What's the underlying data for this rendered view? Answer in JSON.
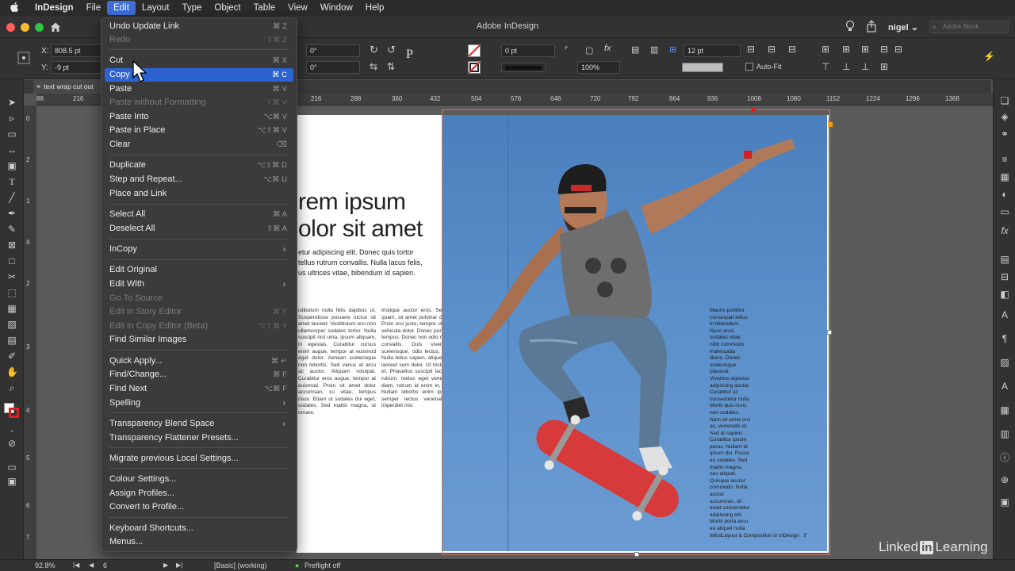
{
  "menubar": {
    "app": "InDesign",
    "items": [
      "File",
      "Edit",
      "Layout",
      "Type",
      "Object",
      "Table",
      "View",
      "Window",
      "Help"
    ]
  },
  "titlebar": {
    "title": "Adobe InDesign",
    "user": "nigel",
    "stock_placeholder": "Adobe Stock"
  },
  "control": {
    "x_label": "X:",
    "x_value": "808.5 pt",
    "y_label": "Y:",
    "y_value": "-9 pt",
    "rotate_value": "0°",
    "shear_value": "0°",
    "stroke_weight": "0 pt",
    "opacity": "100%",
    "gutter": "12 pt",
    "autofit": "Auto-Fit"
  },
  "doc_tab": "text wrap cut out",
  "ruler_h": [
    "88",
    "216",
    "216",
    "288",
    "360",
    "432",
    "504",
    "576",
    "648",
    "720",
    "792",
    "864",
    "936",
    "1008",
    "1080",
    "1152",
    "1224",
    "1296",
    "1368"
  ],
  "ruler_v": [
    "0",
    "2",
    "1",
    "4",
    "2",
    "3",
    "4",
    "5",
    "6",
    "7"
  ],
  "document": {
    "headline_1": "rem ipsum",
    "headline_2": "olor sit amet",
    "intro_1": "etur adipiscing elit. Donec quis tortor",
    "intro_2": "tellus rutrum convallis. Nulla lacus felis,",
    "intro_3": "us ultrices vitae, bibendum id sapien.",
    "col1": "istibulum nulla felis dapibus ut. Suspendisse posuere luctus sit amet laoreet. Vestibulum orci non ullamcorper sodales tortor. Nulla suscipit nisi uma, ipsum aliquam, in egestas. Curabitur cursus enim augue, tempor at euismod eget dolor. Aenean scelerisque non lobortis. Sed varius at arcu ac auctor. Aliquam volutpat. Curabitur eros augue, tempor at euismod. Proin sit amet dolor accumsan, cu vitae, tempus risus. Etiam ut sodales dui eget, sodales. Sed mattis magna, ut ornare.",
    "col2": "tristique auctor eros. Sed vulputate ultrices quam, sit amet pulvinar diam ullamcorper eu. Proin orci justo, tempor ut enim eget, posuere vehicula dolor. Donec porta eros id sollicitudin tempus. Donec non odio nec magna dignissim convallis. Duis viverra sed lobortis scelerisque, odio lectus, eget cursus ipsum. Nulla tellus sapien, aliquet sit amet arcu quis, laoreet sem dolor. Ut tristique lacus in sagittis et. Phasellus suscipit lacinia. Nulla mattis at rutrum, metus eget venenatis feugiat. Justo diam, rutrum id enim in, mollis ultrices nibh. Nullam lobortis enim ipsum, sed hendrerit semper lectus venenatis. Praesent quis imperdiet nisi.",
    "col3": "Mauris porttitor consequat tellus in bibendum. Nunc eros, sodales vitae nibh commodo malesuada libero. Donec scelerisque placerat. Vivamus egestas adipiscing auctor. Curabitur ac consectetur nulla. Morbi quis nunc non sodales. Nam sit amet orci ac, venenatis et. Sed at sapien. Curabitur ipsum purus. Nullam id ipsum dui. Fusce eu sodales. Sed mattis magna, nec aliquet. Quisque auctor commodo. Nulla auctor accumsan, sit amet consectetur adipiscing elit. Morbi porta arcu eu aliquet nulla tellus.",
    "footer": "Layout & Composition in InDesign",
    "page_number": "7"
  },
  "edit_menu": {
    "items": [
      {
        "label": "Undo Update Link",
        "shortcut": "⌘ Z",
        "disabled": false,
        "highlighted": false
      },
      {
        "label": "Redo",
        "shortcut": "⇧⌘ Z",
        "disabled": true,
        "highlighted": false
      },
      {
        "label": "Cut",
        "shortcut": "⌘ X",
        "disabled": false,
        "highlighted": false
      },
      {
        "label": "Copy",
        "shortcut": "⌘ C",
        "disabled": false,
        "highlighted": true
      },
      {
        "label": "Paste",
        "shortcut": "⌘ V",
        "disabled": false,
        "highlighted": false
      },
      {
        "label": "Paste without Formatting",
        "shortcut": "⇧⌘ V",
        "disabled": true,
        "highlighted": false
      },
      {
        "label": "Paste Into",
        "shortcut": "⌥⌘ V",
        "disabled": false,
        "highlighted": false
      },
      {
        "label": "Paste in Place",
        "shortcut": "⌥⇧⌘ V",
        "disabled": false,
        "highlighted": false
      },
      {
        "label": "Clear",
        "shortcut": "⌫",
        "disabled": false,
        "highlighted": false
      },
      {
        "label": "Duplicate",
        "shortcut": "⌥⇧⌘ D",
        "disabled": false,
        "highlighted": false
      },
      {
        "label": "Step and Repeat...",
        "shortcut": "⌥⌘ U",
        "disabled": false,
        "highlighted": false
      },
      {
        "label": "Place and Link",
        "shortcut": "",
        "disabled": false,
        "highlighted": false
      },
      {
        "label": "Select All",
        "shortcut": "⌘ A",
        "disabled": false,
        "highlighted": false
      },
      {
        "label": "Deselect All",
        "shortcut": "⇧⌘ A",
        "disabled": false,
        "highlighted": false
      },
      {
        "label": "InCopy",
        "shortcut": "",
        "disabled": false,
        "highlighted": false,
        "submenu": true
      },
      {
        "label": "Edit Original",
        "shortcut": "",
        "disabled": false,
        "highlighted": false
      },
      {
        "label": "Edit With",
        "shortcut": "",
        "disabled": false,
        "highlighted": false,
        "submenu": true
      },
      {
        "label": "Go To Source",
        "shortcut": "",
        "disabled": true,
        "highlighted": false
      },
      {
        "label": "Edit in Story Editor",
        "shortcut": "⌘ Y",
        "disabled": true,
        "highlighted": false
      },
      {
        "label": "Edit in Copy Editor (Beta)",
        "shortcut": "⌥⇧⌘ Y",
        "disabled": true,
        "highlighted": false
      },
      {
        "label": "Find Similar Images",
        "shortcut": "",
        "disabled": false,
        "highlighted": false
      },
      {
        "label": "Quick Apply...",
        "shortcut": "⌘ ↵",
        "disabled": false,
        "highlighted": false
      },
      {
        "label": "Find/Change...",
        "shortcut": "⌘ F",
        "disabled": false,
        "highlighted": false
      },
      {
        "label": "Find Next",
        "shortcut": "⌥⌘ F",
        "disabled": false,
        "highlighted": false
      },
      {
        "label": "Spelling",
        "shortcut": "",
        "disabled": false,
        "highlighted": false,
        "submenu": true
      },
      {
        "label": "Transparency Blend Space",
        "shortcut": "",
        "disabled": false,
        "highlighted": false,
        "submenu": true
      },
      {
        "label": "Transparency Flattener Presets...",
        "shortcut": "",
        "disabled": false,
        "highlighted": false
      },
      {
        "label": "Migrate previous Local Settings...",
        "shortcut": "",
        "disabled": false,
        "highlighted": false
      },
      {
        "label": "Colour Settings...",
        "shortcut": "",
        "disabled": false,
        "highlighted": false
      },
      {
        "label": "Assign Profiles...",
        "shortcut": "",
        "disabled": false,
        "highlighted": false
      },
      {
        "label": "Convert to Profile...",
        "shortcut": "",
        "disabled": false,
        "highlighted": false
      },
      {
        "label": "Keyboard Shortcuts...",
        "shortcut": "",
        "disabled": false,
        "highlighted": false
      },
      {
        "label": "Menus...",
        "shortcut": "",
        "disabled": false,
        "highlighted": false
      }
    ]
  },
  "status": {
    "zoom": "92.8%",
    "page": "6",
    "style": "[Basic] (working)",
    "preflight": "Preflight off"
  },
  "watermark": {
    "linked": "Linked",
    "in": "in",
    "learning": "Learning"
  },
  "colors": {
    "menu_highlight": "#2d62d1",
    "menubar_active": "#3d6fd8",
    "sky": "#5a8fca",
    "skateboard": "#d63a3a"
  }
}
